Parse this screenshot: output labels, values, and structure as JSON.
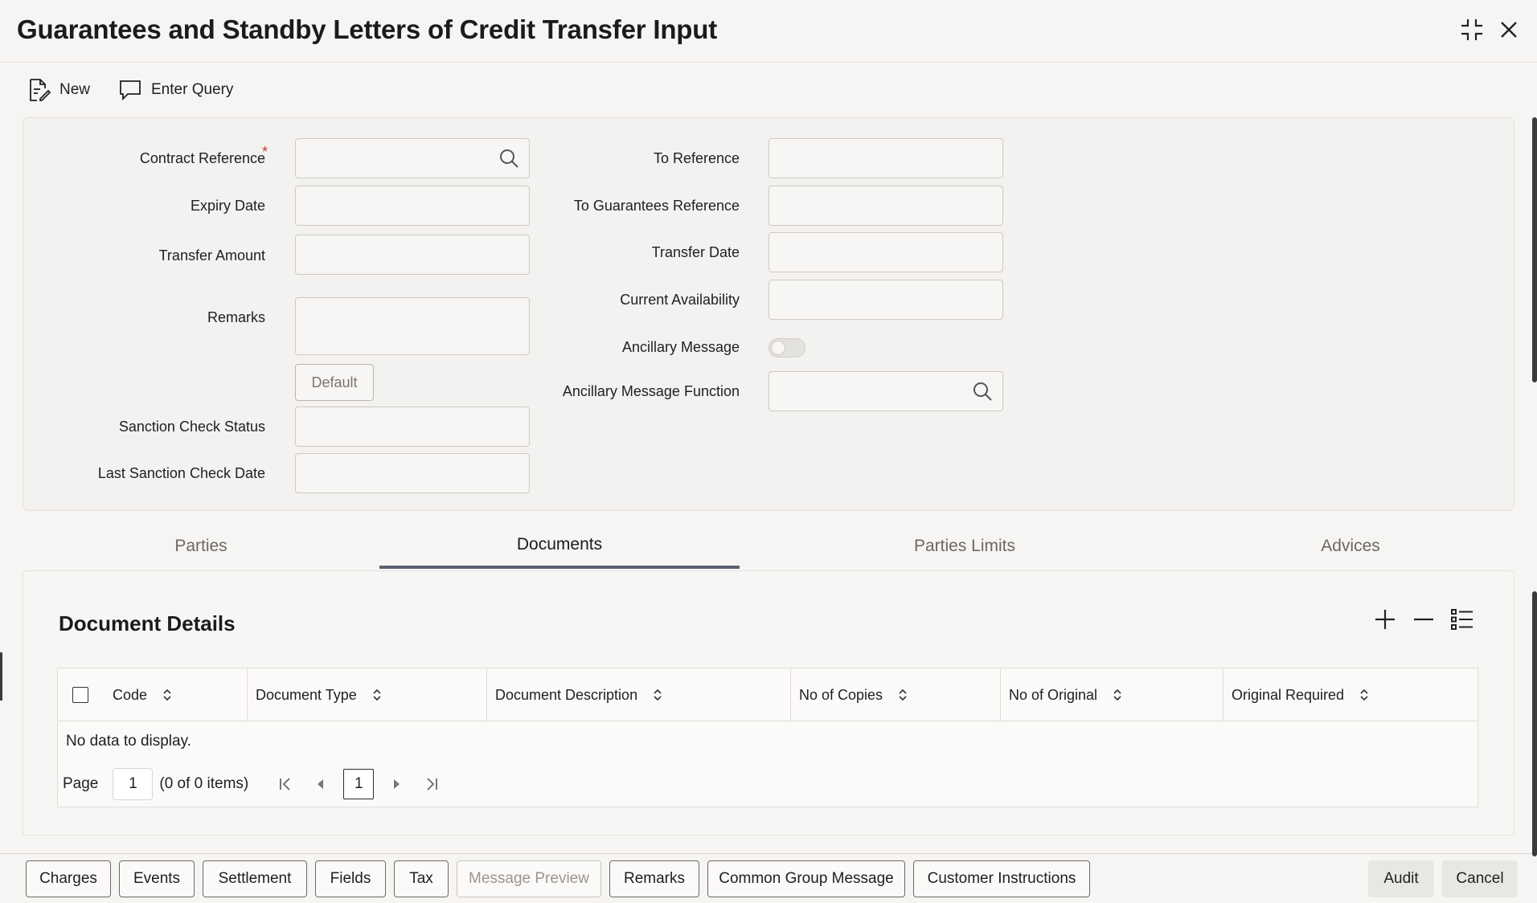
{
  "header": {
    "title": "Guarantees and Standby Letters of Credit Transfer Input",
    "icons": {
      "restore": "shrink-icon",
      "close": "close-icon"
    }
  },
  "toolbar": {
    "new_label": "New",
    "enter_query_label": "Enter Query",
    "icons": {
      "new": "new-document-icon",
      "enter_query": "comment-icon"
    }
  },
  "form": {
    "left": {
      "contract_reference": {
        "label": "Contract Reference",
        "value": "",
        "required_mark": "*"
      },
      "expiry_date": {
        "label": "Expiry Date",
        "value": ""
      },
      "transfer_amount": {
        "label": "Transfer Amount",
        "value": ""
      },
      "remarks": {
        "label": "Remarks",
        "value": ""
      },
      "default_button": "Default",
      "sanction_check_status": {
        "label": "Sanction Check Status",
        "value": ""
      },
      "last_sanction_check_date": {
        "label": "Last Sanction Check Date",
        "value": ""
      }
    },
    "right": {
      "to_reference": {
        "label": "To Reference",
        "value": ""
      },
      "to_guarantees_reference": {
        "label": "To Guarantees Reference",
        "value": ""
      },
      "transfer_date": {
        "label": "Transfer Date",
        "value": ""
      },
      "current_availability": {
        "label": "Current Availability",
        "value": ""
      },
      "ancillary_message": {
        "label": "Ancillary Message",
        "checked": false
      },
      "ancillary_message_function": {
        "label": "Ancillary Message Function",
        "value": ""
      }
    }
  },
  "tabs": [
    {
      "label": "Parties",
      "active": false
    },
    {
      "label": "Documents",
      "active": true
    },
    {
      "label": "Parties Limits",
      "active": false
    },
    {
      "label": "Advices",
      "active": false
    }
  ],
  "documents": {
    "title": "Document Details",
    "columns": [
      "Code",
      "Document Type",
      "Document Description",
      "No of Copies",
      "No of Original",
      "Original Required"
    ],
    "rows": [],
    "empty_text": "No data to display.",
    "pager": {
      "page_label": "Page",
      "page_value": "1",
      "summary": "(0 of 0 items)",
      "current_page": "1"
    }
  },
  "footer": {
    "buttons": [
      "Charges",
      "Events",
      "Settlement",
      "Fields",
      "Tax",
      "Message Preview",
      "Remarks",
      "Common Group Message",
      "Customer Instructions"
    ],
    "disabled": [
      "Message Preview"
    ],
    "audit_label": "Audit",
    "cancel_label": "Cancel"
  },
  "colors": {
    "background": "#f6f5f3",
    "panel": "#f3f2f0",
    "active_tab_underline": "#5a6270",
    "required": "#c0392b"
  }
}
